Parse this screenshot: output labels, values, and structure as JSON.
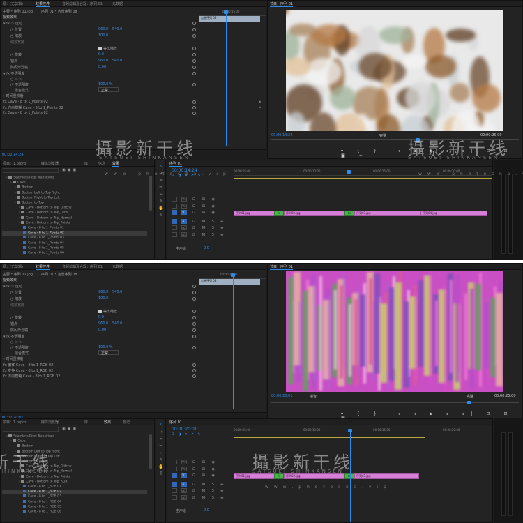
{
  "accent": "#2d8ceb",
  "clip_color": "#d57fd6",
  "transition_color": "#47b34a",
  "watermark": {
    "main": "攝影新干线",
    "sub": "SATSUEI SHINKANSEN",
    "url": "w w w . p h o t o s k a . v i p"
  },
  "shots": [
    {
      "effect_controls": {
        "tabs": [
          "源：(无剪辑)",
          "效果控件",
          "音频剪辑混合器：序列 01",
          "元数据"
        ],
        "source_line": "主要 * 序列 01.jpg",
        "sequence_line": "序列 01 * 吉普序列 08",
        "clip_label": "吉普序列 08",
        "sections": [
          "视频效果"
        ],
        "timecode_top": "00:00:15:00",
        "motion": "运动",
        "position_label": "位置",
        "position_x": "960.0",
        "position_y": "540.0",
        "scale_label": "缩放",
        "scale": "100.0",
        "scale_width_label": "缩放宽度",
        "uniform_label": "等比缩放",
        "rotation_label": "旋转",
        "rotation": "0.0",
        "anchor_label": "锚点",
        "anchor_x": "960.0",
        "anchor_y": "540.0",
        "flicker_label": "防闪烁滤镜",
        "flicker": "0.00",
        "opacity_label": "不透明度",
        "opacity_sub_label": "不透明度",
        "opacity": "100.0 %",
        "blend_label": "混合模式",
        "blend": "正常",
        "remap_label": "时间重映射",
        "fx": [
          "Cave - 8 to 1_Points 02",
          "Cave - 8 to 1_Points 02",
          "Cave - 8 to 1_Points 02"
        ],
        "fx_prefix": [
          "fx  Cave - 8 to 1_Points 02",
          "fx  方向模糊 Cave - 8 to 1_Points 02",
          "fx  Cave - 8 to 1_Points 02"
        ],
        "timecode_bottom": "00:00:14:24"
      },
      "program": {
        "title": "节目：序列 01",
        "timecode": "00:00:14:24",
        "fit": "完整",
        "duration": "00:00:25:00",
        "quality": "完整"
      },
      "project": {
        "tabs": [
          "项目：1.prproj",
          "媒体浏览器",
          "库",
          "信息",
          "效果"
        ],
        "items": [
          {
            "label": "Seamless Pixel Transitions",
            "indent": 1,
            "folder": true
          },
          {
            "label": "Cave",
            "indent": 2,
            "folder": true
          },
          {
            "label": "Bottom",
            "indent": 3,
            "folder": true
          },
          {
            "label": "Bottom Left to Top Right",
            "indent": 3,
            "folder": true
          },
          {
            "label": "Bottom Right to Top Left",
            "indent": 3,
            "folder": true
          },
          {
            "label": "Bottom to Top",
            "indent": 3,
            "folder": true
          },
          {
            "label": "Cave - Bottom to Top_Glitchy",
            "indent": 4,
            "folder": true
          },
          {
            "label": "Cave - Bottom to Top_Lens",
            "indent": 4,
            "folder": true
          },
          {
            "label": "Cave - Bottom to Top_Normal",
            "indent": 4,
            "folder": true
          },
          {
            "label": "Cave - Bottom to Top_Points",
            "indent": 4,
            "folder": true
          },
          {
            "label": "Cave - 8 to 1_Points 01",
            "indent": 5,
            "folder": false
          },
          {
            "label": "Cave - 8 to 1_Points 02",
            "indent": 5,
            "folder": false,
            "selected": true
          },
          {
            "label": "Cave - 8 to 1_Points 03",
            "indent": 5,
            "folder": false
          },
          {
            "label": "Cave - 8 to 1_Points 04",
            "indent": 5,
            "folder": false
          },
          {
            "label": "Cave - 8 to 1_Points 05",
            "indent": 5,
            "folder": false
          },
          {
            "label": "Cave - 8 to 1_Points 06",
            "indent": 5,
            "folder": false
          }
        ]
      },
      "timeline": {
        "tab": "序列 01",
        "timecode": "00:00:14:24",
        "ruler": [
          "00:00:05:00",
          "00:00:10:00",
          "00:00:15:00",
          "00:00:20:00"
        ],
        "tracks": [
          "V3",
          "V2",
          "V1",
          "A1",
          "A2",
          "A3"
        ],
        "master": "主声道",
        "master_value": "0.0",
        "clips": [
          "序列01.jpg",
          "序列02.jpg",
          "序列03.jpg",
          "序列04.jpg",
          "序列05.jpg"
        ]
      }
    },
    {
      "effect_controls": {
        "tabs": [
          "源：(无剪辑)",
          "效果控件",
          "音频剪辑混合器：序列 01",
          "元数据"
        ],
        "source_line": "主要 * 序列 01.jpg",
        "sequence_line": "序列 01 * 吉普序列 08",
        "clip_label": "吉普序列 08",
        "sections": [
          "视频效果"
        ],
        "timecode_top": "00:00:20:00",
        "motion": "运动",
        "position_label": "位置",
        "position_x": "960.0",
        "position_y": "540.0",
        "scale_label": "缩放",
        "scale": "100.0",
        "scale_width_label": "缩放宽度",
        "uniform_label": "等比缩放",
        "rotation_label": "旋转",
        "rotation": "0.0",
        "anchor_label": "锚点",
        "anchor_x": "960.0",
        "anchor_y": "540.0",
        "flicker_label": "防闪烁滤镜",
        "flicker": "0.00",
        "opacity_label": "不透明度",
        "opacity_sub_label": "不透明度",
        "opacity": "100.0 %",
        "blend_label": "混合模式",
        "blend": "正常",
        "remap_label": "时间重映射",
        "fx": [
          "Cave - 8 to 1_RGB 02",
          "Cave - 8 to 1_RGB 02",
          "Cave - 8 to 1_RGB 02"
        ],
        "fx_prefix": [
          "fx  偏移 Cave - 8 to 1_RGB 02",
          "fx  变换 Cave - 8 to 1_RGB 02",
          "fx  方向模糊 Cave - 8 to 1_RGB 02"
        ],
        "timecode_bottom": "00:00:20:01"
      },
      "program": {
        "title": "节目：序列 01",
        "timecode": "00:00:20:01",
        "fit": "适合",
        "duration": "00:00:25:00",
        "quality": "完整"
      },
      "project": {
        "tabs": [
          "项目：1.prproj",
          "媒体浏览器",
          "库",
          "信息",
          "效果",
          "标记"
        ],
        "items": [
          {
            "label": "Seamless Pixel Transitions",
            "indent": 1,
            "folder": true
          },
          {
            "label": "Cave",
            "indent": 2,
            "folder": true
          },
          {
            "label": "Bottom",
            "indent": 3,
            "folder": true
          },
          {
            "label": "Bottom Left to Top Right",
            "indent": 3,
            "folder": true
          },
          {
            "label": "Bottom Right to Top Left",
            "indent": 3,
            "folder": true
          },
          {
            "label": "Bottom to Top",
            "indent": 3,
            "folder": true
          },
          {
            "label": "Cave - Bottom to Top_Glitchy",
            "indent": 4,
            "folder": true
          },
          {
            "label": "Cave - Bottom to Top_Normal",
            "indent": 4,
            "folder": true
          },
          {
            "label": "Cave - Bottom to Top_Points",
            "indent": 4,
            "folder": true
          },
          {
            "label": "Cave - Bottom to Top_RGB",
            "indent": 4,
            "folder": true
          },
          {
            "label": "Cave - 8 to 1_RGB 01",
            "indent": 5,
            "folder": false
          },
          {
            "label": "Cave - 8 to 1_RGB 02",
            "indent": 5,
            "folder": false,
            "selected": true
          },
          {
            "label": "Cave - 8 to 1_RGB 03",
            "indent": 5,
            "folder": false
          },
          {
            "label": "Cave - 8 to 1_RGB 04",
            "indent": 5,
            "folder": false
          },
          {
            "label": "Cave - 8 to 1_RGB 05",
            "indent": 5,
            "folder": false
          },
          {
            "label": "Cave - 8 to 1_RGB 06",
            "indent": 5,
            "folder": false
          }
        ]
      },
      "timeline": {
        "tab": "序列 01",
        "timecode": "00:00:20:01",
        "ruler": [
          "00:00:05:00",
          "00:00:10:00",
          "00:00:15:00",
          "00:00:20:00",
          "00:00:25:00"
        ],
        "tracks": [
          "V3",
          "V2",
          "V1",
          "A1",
          "A2",
          "A3"
        ],
        "master": "主声道",
        "master_value": "0.0",
        "clips": [
          "序列01.jpg",
          "序列02.jpg",
          "序列03.jpg",
          "序列04.jpg"
        ]
      }
    }
  ]
}
